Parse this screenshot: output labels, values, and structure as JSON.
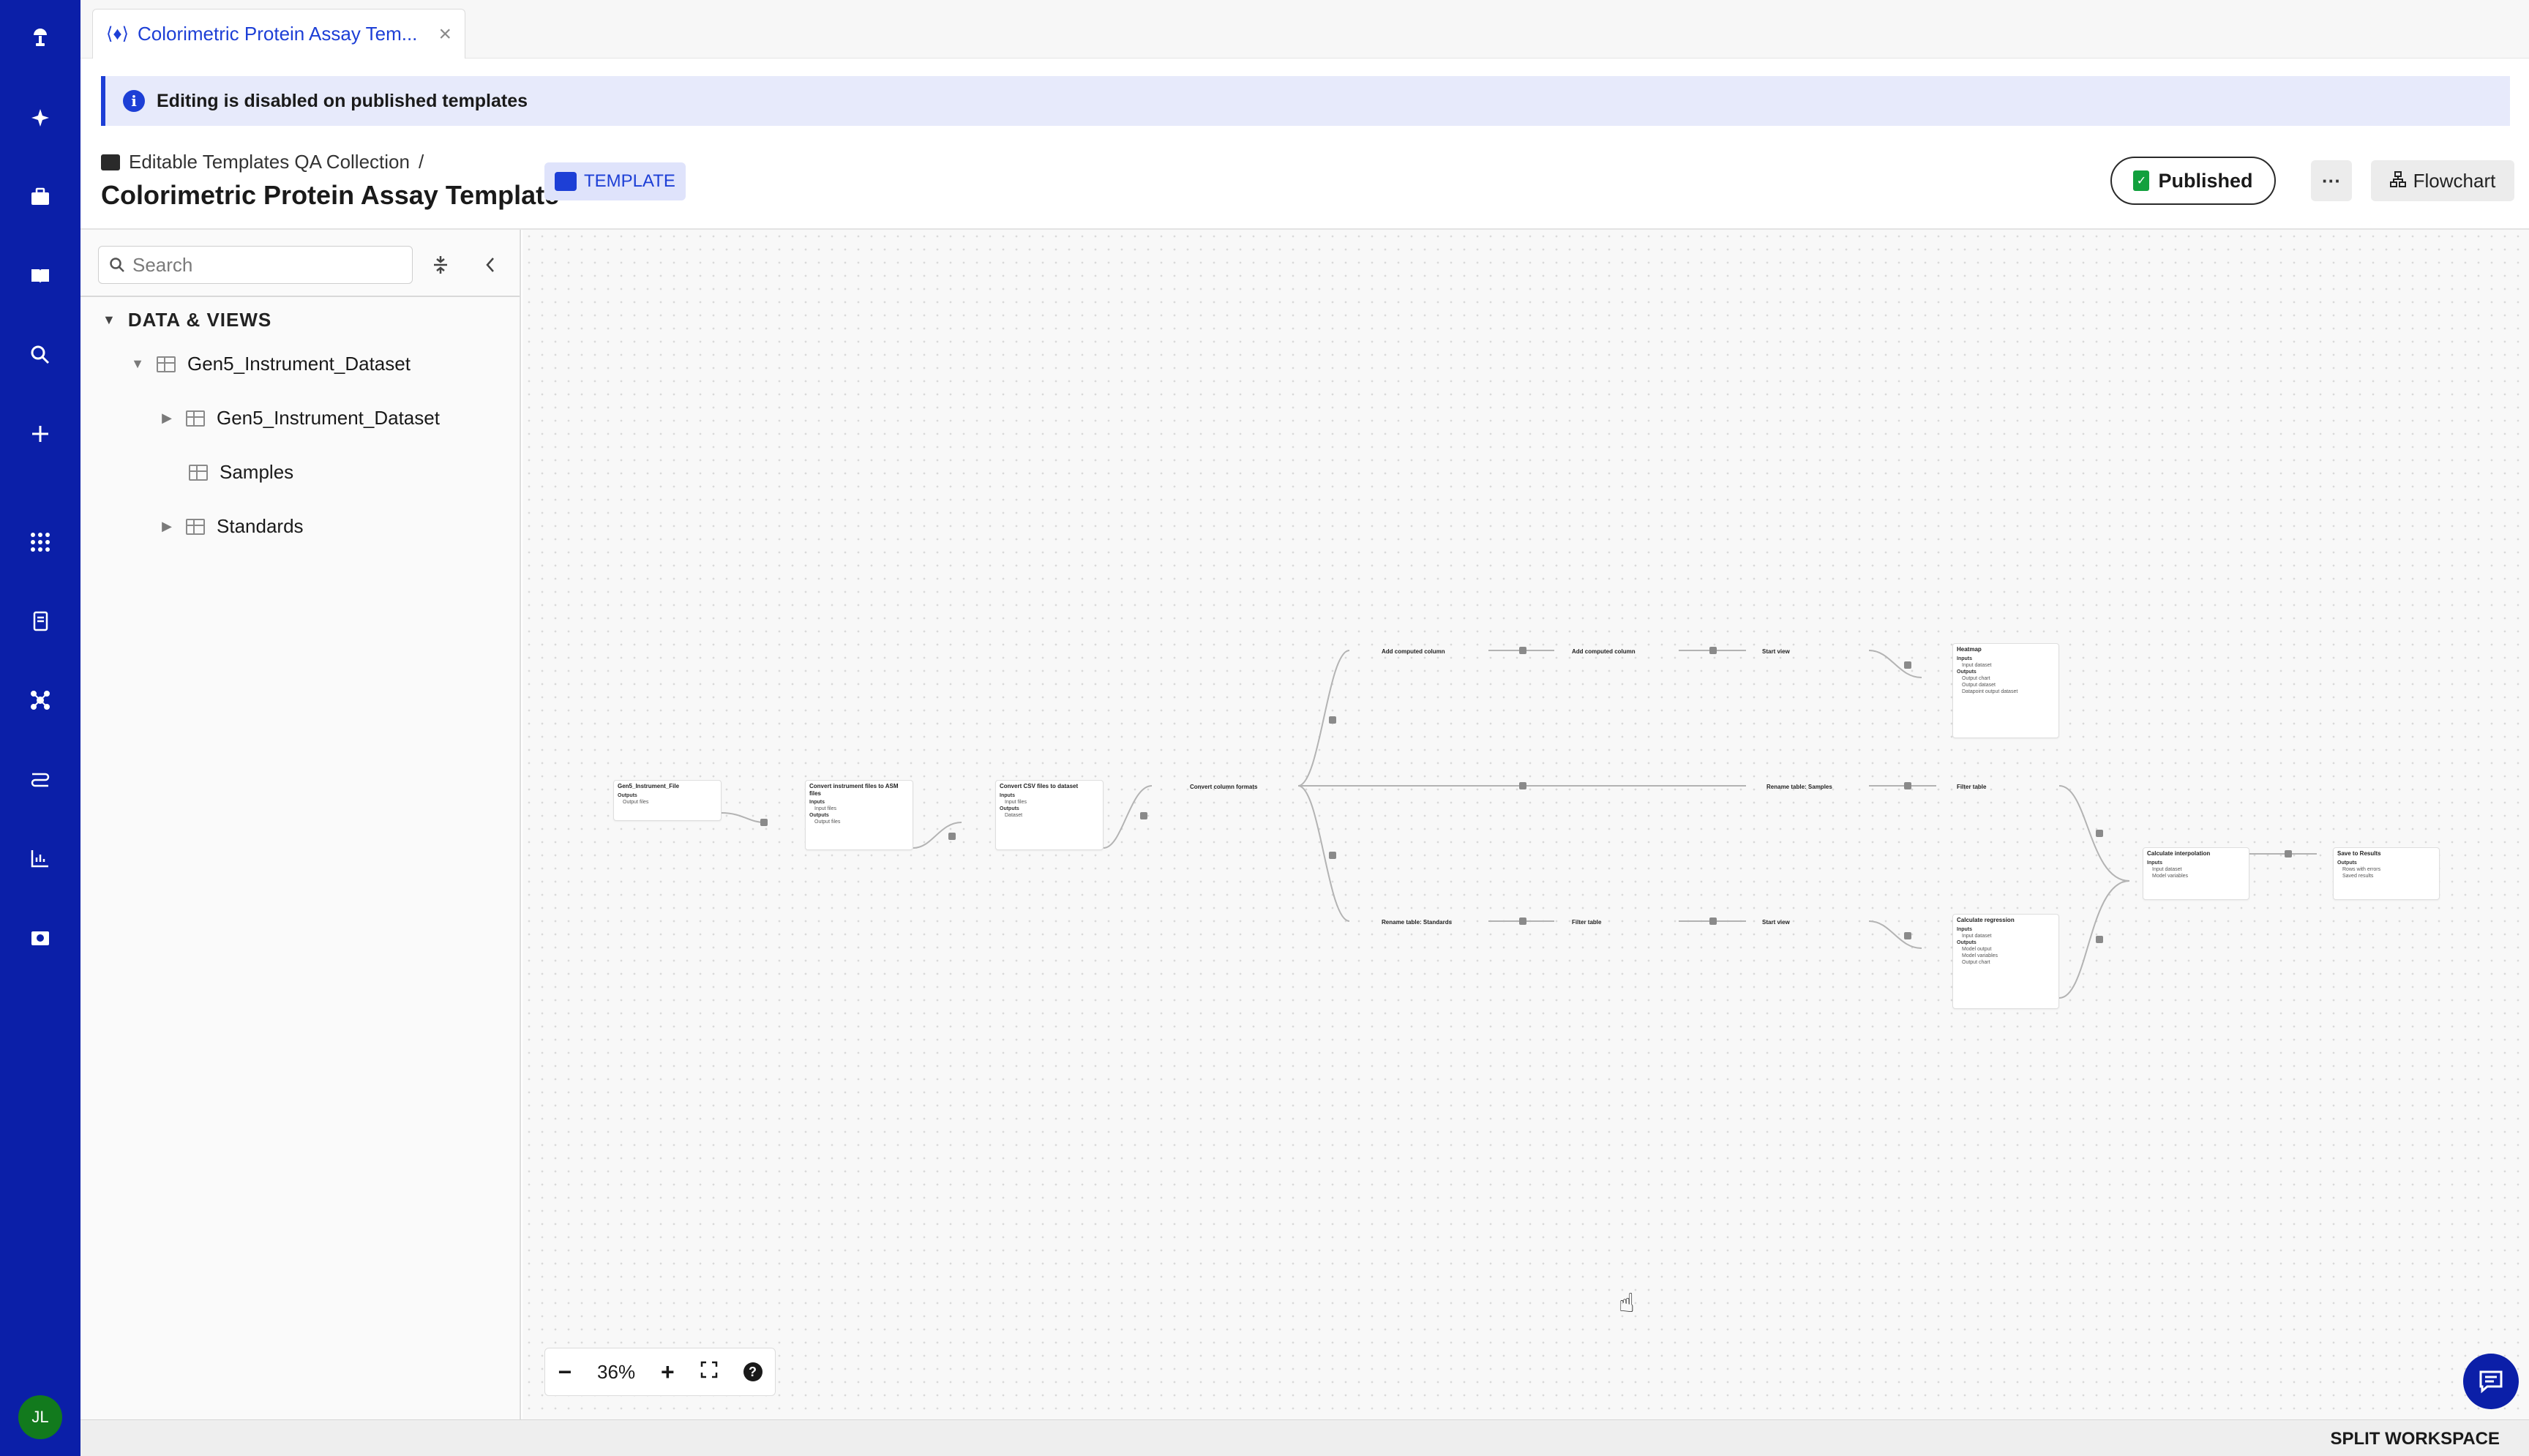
{
  "rail": {
    "items": [
      "logo-icon",
      "sparkle-icon",
      "briefcase-icon",
      "book-icon",
      "search-icon",
      "plus-icon",
      "apps-grid-icon",
      "notebook-icon",
      "molecule-icon",
      "workflow-icon",
      "chart-icon",
      "camera-folder-icon"
    ],
    "avatar_initials": "JL"
  },
  "tab": {
    "title": "Colorimetric Protein Assay Tem..."
  },
  "banner": {
    "text": "Editing is disabled on published templates"
  },
  "header": {
    "breadcrumb": "Editable Templates QA Collection",
    "breadcrumb_sep": "/",
    "title": "Colorimetric Protein Assay Template",
    "badge": "TEMPLATE",
    "published_label": "Published",
    "more_label": "···",
    "flowchart_label": "Flowchart"
  },
  "panel": {
    "search_placeholder": "Search",
    "section_title": "DATA & VIEWS",
    "tree": [
      {
        "label": "Gen5_Instrument_Dataset",
        "caret": "▼"
      },
      {
        "label": "Gen5_Instrument_Dataset",
        "caret": "▶"
      },
      {
        "label": "Samples",
        "caret": ""
      },
      {
        "label": "Standards",
        "caret": "▶"
      }
    ]
  },
  "flow": {
    "nodes": {
      "file": {
        "title": "Gen5_Instrument_File",
        "outputs_label": "Outputs",
        "out1": "Output files"
      },
      "convert_asm": {
        "title": "Convert instrument files to ASM files",
        "inputs_label": "Inputs",
        "in1": "Input files",
        "outputs_label": "Outputs",
        "out1": "Output files"
      },
      "convert_csv": {
        "title": "Convert CSV files to dataset",
        "inputs_label": "Inputs",
        "in1": "Input files",
        "outputs_label": "Outputs",
        "out1": "Dataset"
      },
      "convert_cols": {
        "title": "Convert column formats"
      },
      "add_col_1": {
        "title": "Add computed column"
      },
      "add_col_2": {
        "title": "Add computed column"
      },
      "start_view_1": {
        "title": "Start view"
      },
      "heatmap": {
        "title": "Heatmap",
        "inputs_label": "Inputs",
        "in1": "Input dataset",
        "outputs_label": "Outputs",
        "out1": "Output chart",
        "out2": "Output dataset",
        "out3": "Datapoint output dataset"
      },
      "rename_samples": {
        "title": "Rename table: Samples"
      },
      "filter_1": {
        "title": "Filter table"
      },
      "rename_standards": {
        "title": "Rename table: Standards"
      },
      "filter_2": {
        "title": "Filter table"
      },
      "start_view_2": {
        "title": "Start view"
      },
      "calc_regression": {
        "title": "Calculate regression",
        "inputs_label": "Inputs",
        "in1": "Input dataset",
        "outputs_label": "Outputs",
        "out1": "Model output",
        "out2": "Model variables",
        "out3": "Output chart"
      },
      "calc_interp": {
        "title": "Calculate interpolation",
        "inputs_label": "Inputs",
        "in1": "Input dataset",
        "in2": "Model variables"
      },
      "save_results": {
        "title": "Save to Results",
        "outputs_label": "Outputs",
        "out1": "Rows with errors",
        "out2": "Saved results"
      }
    }
  },
  "zoom": {
    "minus": "−",
    "level": "36%",
    "plus": "+",
    "help": "?"
  },
  "footer": {
    "split_workspace": "SPLIT WORKSPACE"
  },
  "colors": {
    "rail": "#0b1fa8",
    "accent": "#1d3fd6",
    "banner_bg": "#e7eafb",
    "published_icon": "#12a03d",
    "avatar": "#127a1d"
  }
}
